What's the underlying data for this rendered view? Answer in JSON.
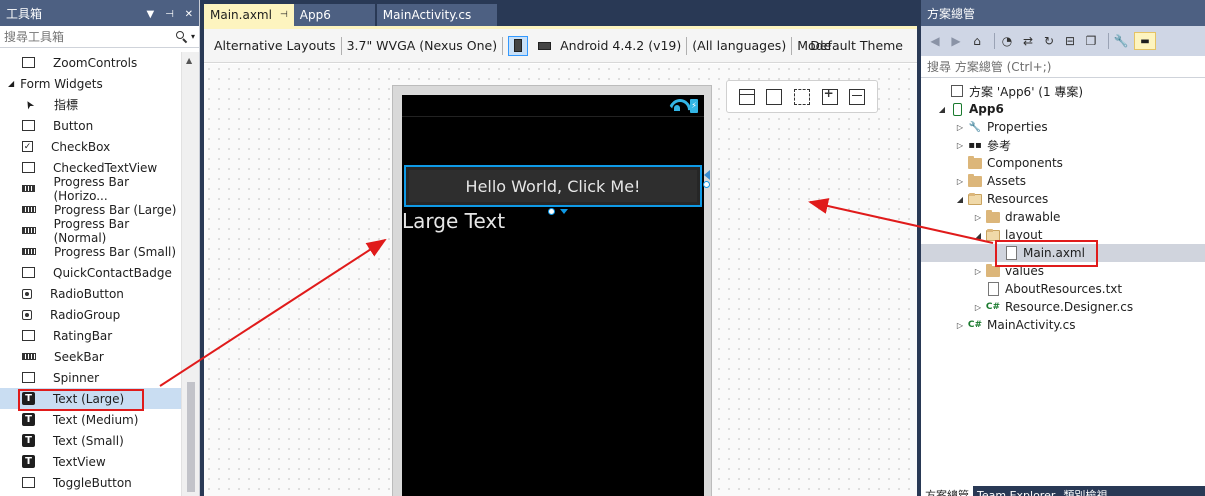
{
  "toolbox": {
    "title": "工具箱",
    "search_placeholder": "搜尋工具箱",
    "items_top": [
      {
        "label": "ZoomControls",
        "icon": "box"
      }
    ],
    "group": "Form Widgets",
    "items": [
      {
        "label": "指標",
        "icon": "pointer"
      },
      {
        "label": "Button",
        "icon": "box"
      },
      {
        "label": "CheckBox",
        "icon": "chk"
      },
      {
        "label": "CheckedTextView",
        "icon": "box"
      },
      {
        "label": "Progress Bar (Horizo...",
        "icon": "prog"
      },
      {
        "label": "Progress Bar (Large)",
        "icon": "prog"
      },
      {
        "label": "Progress Bar (Normal)",
        "icon": "prog"
      },
      {
        "label": "Progress Bar (Small)",
        "icon": "prog"
      },
      {
        "label": "QuickContactBadge",
        "icon": "box"
      },
      {
        "label": "RadioButton",
        "icon": "radio"
      },
      {
        "label": "RadioGroup",
        "icon": "radio"
      },
      {
        "label": "RatingBar",
        "icon": "box"
      },
      {
        "label": "SeekBar",
        "icon": "prog"
      },
      {
        "label": "Spinner",
        "icon": "box"
      },
      {
        "label": "Text (Large)",
        "icon": "t",
        "selected": true
      },
      {
        "label": "Text (Medium)",
        "icon": "t"
      },
      {
        "label": "Text (Small)",
        "icon": "t"
      },
      {
        "label": "TextView",
        "icon": "t"
      },
      {
        "label": "ToggleButton",
        "icon": "box"
      }
    ]
  },
  "editor": {
    "tabs": [
      {
        "label": "Main.axml",
        "active": true
      },
      {
        "label": "App6",
        "active": false
      },
      {
        "label": "MainActivity.cs",
        "active": false
      }
    ],
    "designer_bar": {
      "alt_layouts": "Alternative Layouts",
      "device": "3.7\" WVGA (Nexus One)",
      "api": "Android 4.4.2 (v19)",
      "language": "(All languages)",
      "mode": "Mode",
      "theme": "Default Theme"
    },
    "phone": {
      "button_text": "Hello World, Click Me!",
      "large_text": "Large Text"
    }
  },
  "solution": {
    "title": "方案總管",
    "search_placeholder": "搜尋 方案總管 (Ctrl+;)",
    "tree": [
      {
        "label": "方案 'App6' (1 專案)",
        "depth": 0,
        "exp": "",
        "icon": "sln"
      },
      {
        "label": "App6",
        "depth": 0,
        "exp": "◢",
        "icon": "proj",
        "bold": true
      },
      {
        "label": "Properties",
        "depth": 1,
        "exp": "▷",
        "icon": "wrench"
      },
      {
        "label": "參考",
        "depth": 1,
        "exp": "▷",
        "icon": "ref"
      },
      {
        "label": "Components",
        "depth": 1,
        "exp": "",
        "icon": "folder"
      },
      {
        "label": "Assets",
        "depth": 1,
        "exp": "▷",
        "icon": "folder"
      },
      {
        "label": "Resources",
        "depth": 1,
        "exp": "◢",
        "icon": "folder-open"
      },
      {
        "label": "drawable",
        "depth": 2,
        "exp": "▷",
        "icon": "folder"
      },
      {
        "label": "layout",
        "depth": 2,
        "exp": "◢",
        "icon": "folder-open"
      },
      {
        "label": "Main.axml",
        "depth": 3,
        "exp": "",
        "icon": "file",
        "selected": true
      },
      {
        "label": "values",
        "depth": 2,
        "exp": "▷",
        "icon": "folder"
      },
      {
        "label": "AboutResources.txt",
        "depth": 2,
        "exp": "",
        "icon": "file"
      },
      {
        "label": "Resource.Designer.cs",
        "depth": 2,
        "exp": "▷",
        "icon": "cs"
      },
      {
        "label": "MainActivity.cs",
        "depth": 1,
        "exp": "▷",
        "icon": "cs"
      }
    ],
    "bottom_tabs": [
      "方案總管",
      "Team Explorer",
      "類別檢視"
    ]
  }
}
